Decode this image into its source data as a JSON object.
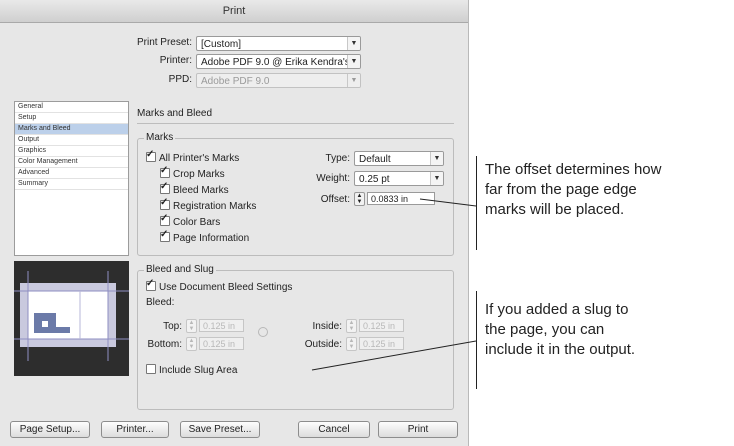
{
  "dialog": {
    "title": "Print",
    "print_preset": {
      "label": "Print Preset:",
      "value": "[Custom]"
    },
    "printer": {
      "label": "Printer:",
      "value": "Adobe PDF 9.0 @ Erika Kendra's Mac..."
    },
    "ppd": {
      "label": "PPD:",
      "value": "Adobe PDF 9.0"
    },
    "sidebar": [
      {
        "label": "General"
      },
      {
        "label": "Setup"
      },
      {
        "label": "Marks and Bleed",
        "active": true
      },
      {
        "label": "Output"
      },
      {
        "label": "Graphics"
      },
      {
        "label": "Color Management"
      },
      {
        "label": "Advanced"
      },
      {
        "label": "Summary"
      }
    ],
    "section_title": "Marks and Bleed",
    "marks": {
      "title": "Marks",
      "all_printers_marks": "All Printer's Marks",
      "crop_marks": "Crop Marks",
      "bleed_marks": "Bleed Marks",
      "registration_marks": "Registration Marks",
      "color_bars": "Color Bars",
      "page_information": "Page Information",
      "type_label": "Type:",
      "type_value": "Default",
      "weight_label": "Weight:",
      "weight_value": "0.25 pt",
      "offset_label": "Offset:",
      "offset_value": "0.0833 in"
    },
    "bleed_slug": {
      "title": "Bleed and Slug",
      "use_document": "Use Document Bleed Settings",
      "bleed_label": "Bleed:",
      "top_label": "Top:",
      "bottom_label": "Bottom:",
      "inside_label": "Inside:",
      "outside_label": "Outside:",
      "top_value": "0.125 in",
      "bottom_value": "0.125 in",
      "inside_value": "0.125 in",
      "outside_value": "0.125 in",
      "include_slug": "Include Slug Area"
    },
    "buttons": {
      "page_setup": "Page Setup...",
      "printer": "Printer...",
      "save_preset": "Save Preset...",
      "cancel": "Cancel",
      "print": "Print"
    }
  },
  "callouts": {
    "offset": [
      "The offset determines how",
      "far from the page edge",
      "marks will be placed."
    ],
    "slug": [
      "If you added a slug to",
      "the page, you can",
      "include it in the output."
    ]
  },
  "colors": {
    "dialog_bg": "#e7e7e7",
    "sidebar_active": "#bcd0ea",
    "preview_bg": "#2d2d2d"
  }
}
